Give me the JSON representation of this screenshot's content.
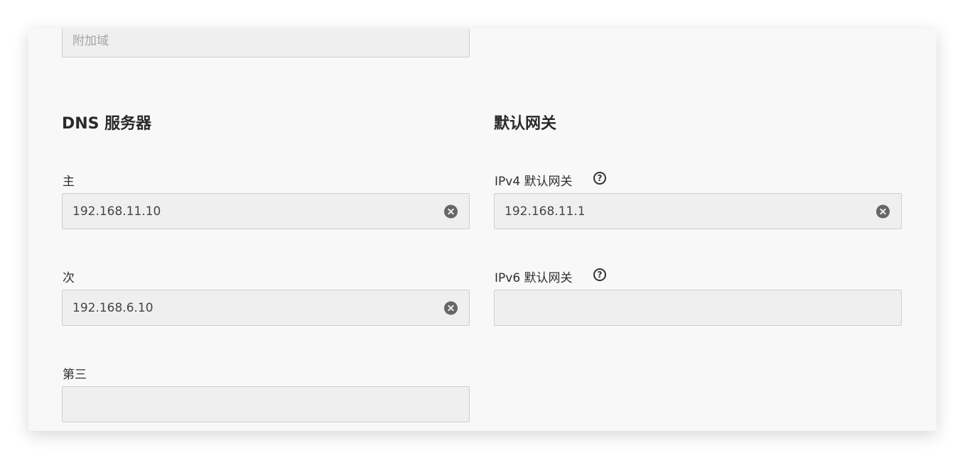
{
  "extra_domain": {
    "placeholder": "附加域",
    "value": ""
  },
  "dns": {
    "title": "DNS 服务器",
    "primary": {
      "label": "主",
      "value": "192.168.11.10"
    },
    "secondary": {
      "label": "次",
      "value": "192.168.6.10"
    },
    "tertiary": {
      "label": "第三",
      "value": ""
    }
  },
  "gateway": {
    "title": "默认网关",
    "ipv4": {
      "label": "IPv4 默认网关",
      "value": "192.168.11.1"
    },
    "ipv6": {
      "label": "IPv6 默认网关",
      "value": ""
    }
  },
  "icons": {
    "clear": "clear-circle-x-icon",
    "help": "question-circle-icon",
    "help_glyph": "?"
  },
  "colors": {
    "panel_bg": "#f8f8f8",
    "field_bg": "#efefef",
    "field_border": "#cfcfcf",
    "text": "#2f2f2f",
    "clear_icon": "#666666"
  }
}
